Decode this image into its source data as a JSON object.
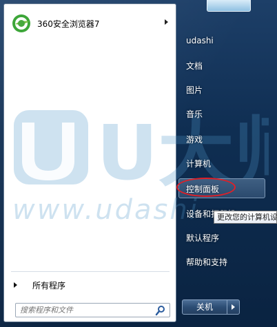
{
  "pinned": {
    "browser_label": "360安全浏览器7",
    "browser_icon": "360-browser-icon"
  },
  "watermark": {
    "logo_text": "U大师",
    "url_text": "www.udashi"
  },
  "left": {
    "all_programs_label": "所有程序",
    "search_placeholder": "搜索程序和文件"
  },
  "right": {
    "user_name": "udashi",
    "items": [
      "文档",
      "图片",
      "音乐",
      "游戏",
      "计算机",
      "控制面板",
      "设备和打印机",
      "默认程序",
      "帮助和支持"
    ],
    "tooltip": "更改您的计算机设"
  },
  "shutdown": {
    "label": "关机"
  },
  "colors": {
    "highlight_ring": "#e21f26",
    "frame": "#1d3f68",
    "watermark": "#5096c8"
  }
}
